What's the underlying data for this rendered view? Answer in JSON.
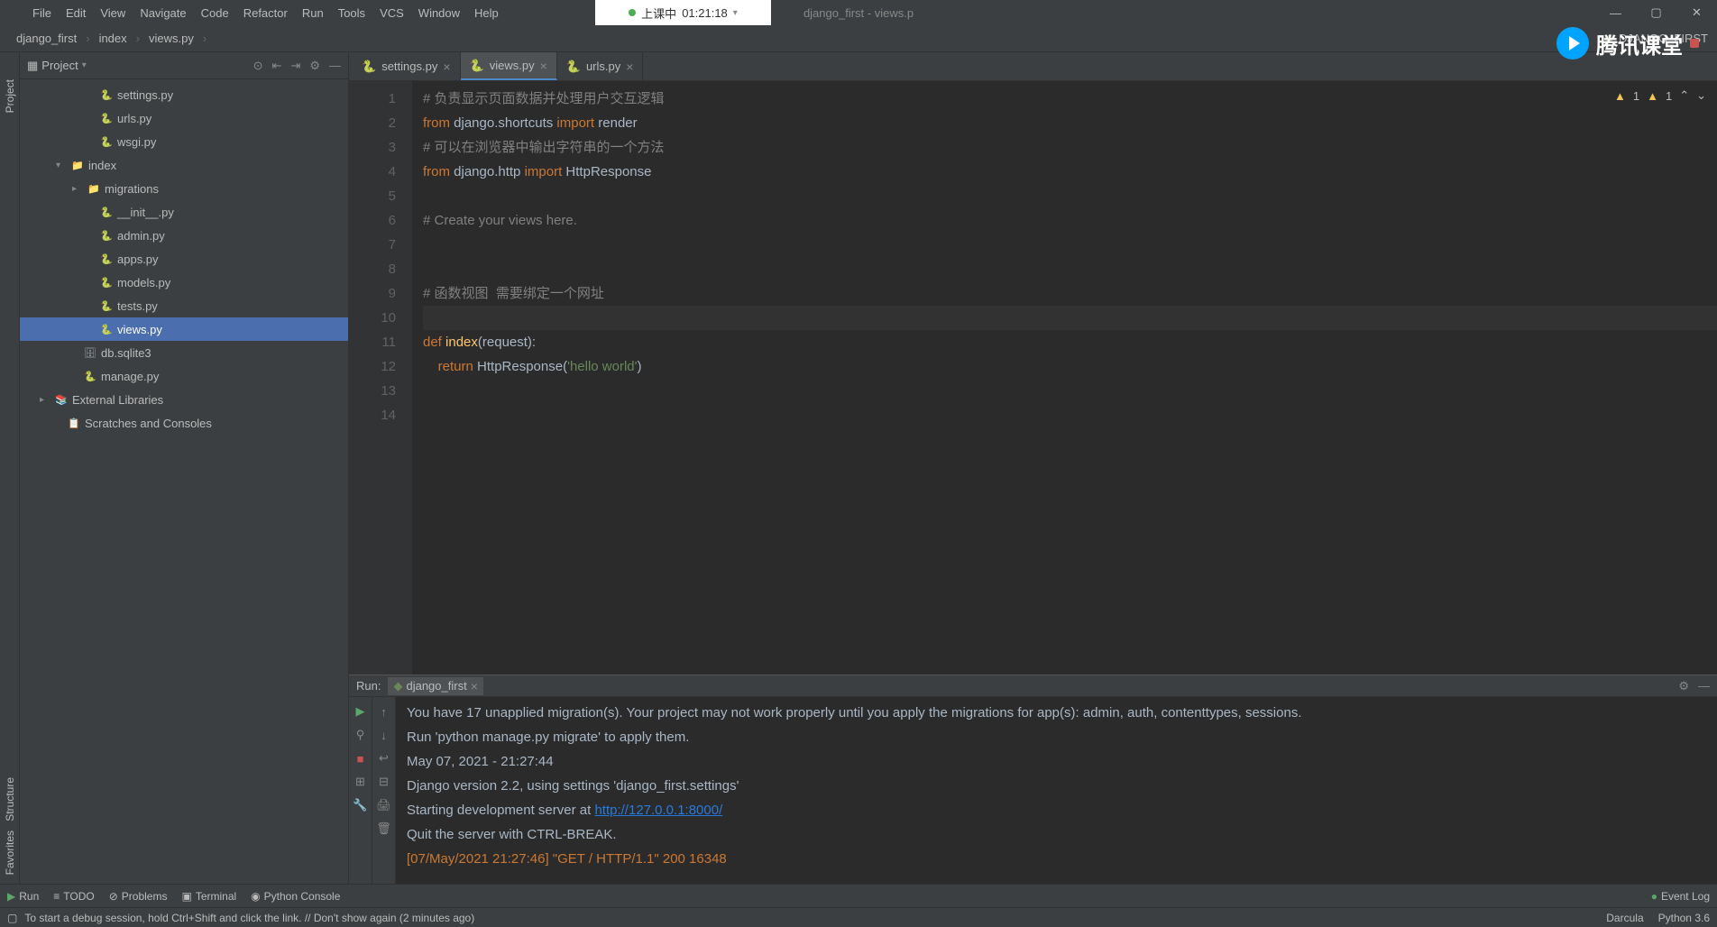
{
  "menus": [
    "File",
    "Edit",
    "View",
    "Navigate",
    "Code",
    "Refactor",
    "Run",
    "Tools",
    "VCS",
    "Window",
    "Help"
  ],
  "window_title": "django_first - views.p",
  "recording": {
    "label": "上课中",
    "time": "01:21:18"
  },
  "breadcrumbs": [
    "django_first",
    "index",
    "views.py"
  ],
  "run_config": "DJANGO_FIRST",
  "watermark": "腾讯课堂",
  "project_panel": {
    "title": "Project",
    "tree": [
      {
        "indent": 60,
        "icon": "py",
        "label": "settings.py",
        "chev": ""
      },
      {
        "indent": 60,
        "icon": "py",
        "label": "urls.py",
        "chev": ""
      },
      {
        "indent": 60,
        "icon": "py",
        "label": "wsgi.py",
        "chev": ""
      },
      {
        "indent": 28,
        "icon": "dir",
        "label": "index",
        "chev": "▾"
      },
      {
        "indent": 46,
        "icon": "dir",
        "label": "migrations",
        "chev": "▸"
      },
      {
        "indent": 60,
        "icon": "py",
        "label": "__init__.py",
        "chev": ""
      },
      {
        "indent": 60,
        "icon": "py",
        "label": "admin.py",
        "chev": ""
      },
      {
        "indent": 60,
        "icon": "py",
        "label": "apps.py",
        "chev": ""
      },
      {
        "indent": 60,
        "icon": "py",
        "label": "models.py",
        "chev": ""
      },
      {
        "indent": 60,
        "icon": "py",
        "label": "tests.py",
        "chev": ""
      },
      {
        "indent": 60,
        "icon": "py",
        "label": "views.py",
        "chev": "",
        "selected": true
      },
      {
        "indent": 42,
        "icon": "db",
        "label": "db.sqlite3",
        "chev": ""
      },
      {
        "indent": 42,
        "icon": "py",
        "label": "manage.py",
        "chev": ""
      },
      {
        "indent": 10,
        "icon": "lib",
        "label": "External Libraries",
        "chev": "▸"
      },
      {
        "indent": 24,
        "icon": "sc",
        "label": "Scratches and Consoles",
        "chev": ""
      }
    ]
  },
  "tabs": [
    {
      "label": "settings.py",
      "active": false
    },
    {
      "label": "views.py",
      "active": true
    },
    {
      "label": "urls.py",
      "active": false
    }
  ],
  "inspections": {
    "err": "1",
    "warn": "1"
  },
  "code_lines": [
    {
      "n": 1,
      "html": "<span class='c-cmt'># 负责显示页面数据并处理用户交互逻辑</span>"
    },
    {
      "n": 2,
      "html": "<span class='c-kw'>from</span><span class='c-norm'> django.shortcuts </span><span class='c-kw'>import</span><span class='c-norm'> render</span>"
    },
    {
      "n": 3,
      "html": "<span class='c-cmt'># 可以在浏览器中输出字符串的一个方法</span>"
    },
    {
      "n": 4,
      "html": "<span class='c-kw'>from</span><span class='c-norm'> django.http </span><span class='c-kw'>import</span><span class='c-norm'> HttpResponse</span>"
    },
    {
      "n": 5,
      "html": ""
    },
    {
      "n": 6,
      "html": "<span class='c-cmt'># Create your views here.</span>"
    },
    {
      "n": 7,
      "html": ""
    },
    {
      "n": 8,
      "html": ""
    },
    {
      "n": 9,
      "html": "<span class='c-cmt'># 函数视图  需要绑定一个网址</span>"
    },
    {
      "n": 10,
      "html": "",
      "current": true
    },
    {
      "n": 11,
      "html": "<span class='c-kw'>def </span><span class='c-fn'>index</span><span class='c-norm'>(request):</span>"
    },
    {
      "n": 12,
      "html": "<span class='c-norm'>    </span><span class='c-kw'>return</span><span class='c-norm'> HttpResponse(</span><span class='c-str'>'hello world'</span><span class='c-norm'>)</span>"
    },
    {
      "n": 13,
      "html": ""
    },
    {
      "n": 14,
      "html": ""
    }
  ],
  "run": {
    "label": "Run:",
    "tab": "django_first",
    "lines": [
      "You have 17 unapplied migration(s). Your project may not work properly until you apply the migrations for app(s): admin, auth, contenttypes, sessions.",
      "Run 'python manage.py migrate' to apply them.",
      "May 07, 2021 - 21:27:44",
      "Django version 2.2, using settings 'django_first.settings'",
      "Starting development server at ",
      "Quit the server with CTRL-BREAK."
    ],
    "url": "http://127.0.0.1:8000/",
    "request": "[07/May/2021 21:27:46] \"GET / HTTP/1.1\" 200 16348"
  },
  "bottom_tools": [
    "Run",
    "TODO",
    "Problems",
    "Terminal",
    "Python Console"
  ],
  "event_log": "Event Log",
  "status": {
    "msg": "To start a debug session, hold Ctrl+Shift and click the link. // Don't show again (2 minutes ago)",
    "right": [
      "Darcula",
      "Python 3.6"
    ]
  },
  "side_labels": {
    "project": "Project",
    "structure": "Structure",
    "favorites": "Favorites"
  }
}
